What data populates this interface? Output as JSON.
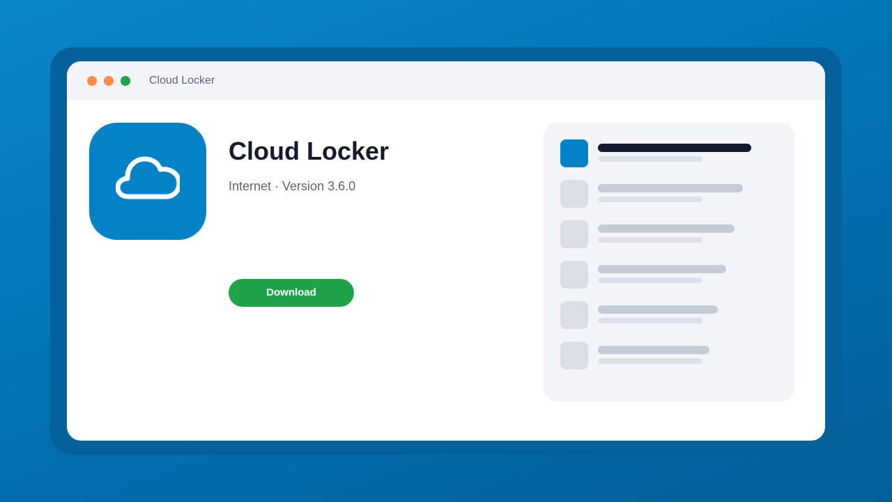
{
  "window": {
    "title": "Cloud Locker"
  },
  "app": {
    "name": "Cloud Locker",
    "meta": "Internet · Version 3.6.0",
    "icon": "cloud-icon",
    "download_label": "Download"
  },
  "preview": {
    "rows": [
      {
        "state": "active"
      },
      {
        "state": "inactive"
      },
      {
        "state": "inactive"
      },
      {
        "state": "inactive"
      },
      {
        "state": "inactive"
      },
      {
        "state": "inactive"
      }
    ]
  },
  "colors": {
    "background": "#0274b4",
    "accent": "#0382c8",
    "download": "#1ea34a",
    "traffic_close": "#fb8c45",
    "traffic_minimize": "#fb8c45",
    "traffic_maximize": "#1fa34a",
    "heading": "#131a2e"
  }
}
